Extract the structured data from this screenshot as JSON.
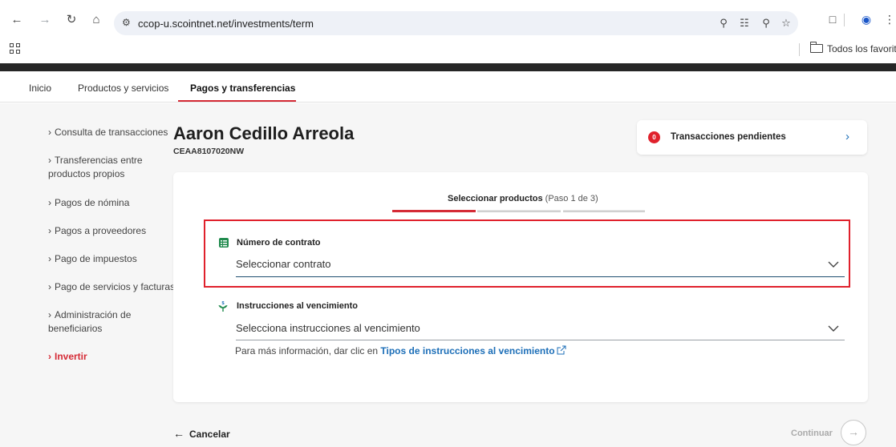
{
  "browser": {
    "url": "ccop-u.scointnet.net/investments/term",
    "bookmarks_folder": "Todos los favoritos"
  },
  "nav": {
    "items": [
      {
        "label": "Inicio"
      },
      {
        "label": "Productos y servicios"
      },
      {
        "label": "Pagos y transferencias"
      }
    ],
    "active_index": 2
  },
  "sidebar": {
    "items": [
      {
        "label": "Consulta de transacciones"
      },
      {
        "label": "Transferencias entre productos propios"
      },
      {
        "label": "Pagos de nómina"
      },
      {
        "label": "Pagos a proveedores"
      },
      {
        "label": "Pago de impuestos"
      },
      {
        "label": "Pago de servicios y facturas"
      },
      {
        "label": "Administración de beneficiarios"
      },
      {
        "label": "Invertir"
      }
    ],
    "active_index": 7
  },
  "user": {
    "name": "Aaron Cedillo Arreola",
    "id": "CEAA8107020NW"
  },
  "pending": {
    "count": "0",
    "label": "Transacciones pendientes"
  },
  "steps": {
    "title": "Seleccionar productos",
    "progress_text": "(Paso 1 de 3)",
    "current": 1,
    "total": 3
  },
  "form": {
    "contract": {
      "label": "Número de contrato",
      "value": "Seleccionar contrato"
    },
    "instructions": {
      "label": "Instrucciones al vencimiento",
      "value": "Selecciona instrucciones al vencimiento"
    },
    "help_prefix": "Para más información, dar clic en ",
    "help_link": "Tipos de instrucciones al vencimiento"
  },
  "footer": {
    "cancel": "Cancelar",
    "continue": "Continuar"
  },
  "colors": {
    "accent_red": "#d52b36",
    "link_blue": "#1d6fb8",
    "field_focus": "#1d4e6f"
  }
}
